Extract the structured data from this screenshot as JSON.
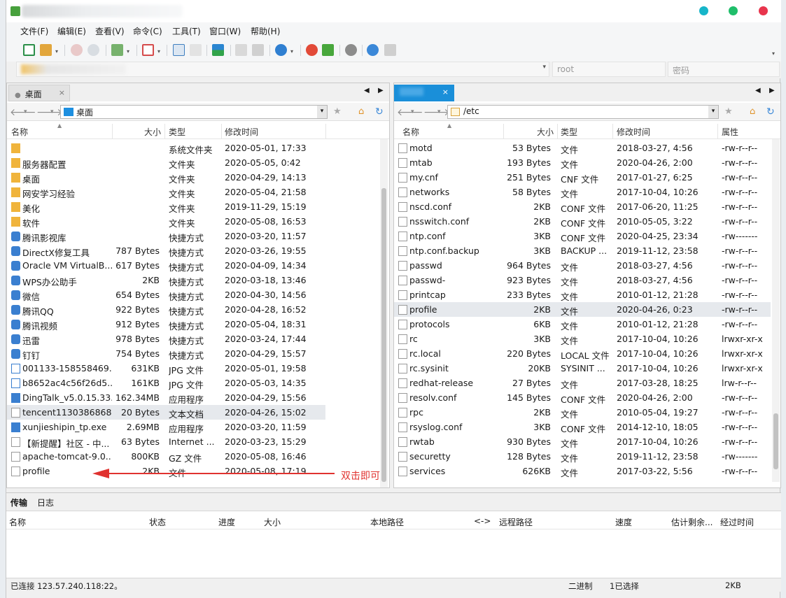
{
  "window": {
    "title": ""
  },
  "menu": [
    "文件(F)",
    "编辑(E)",
    "查看(V)",
    "命令(C)",
    "工具(T)",
    "窗口(W)",
    "帮助(H)"
  ],
  "connection": {
    "user_placeholder": "root",
    "password_placeholder": "密码"
  },
  "left_pane": {
    "tab_label": "桌面",
    "path": "桌面",
    "columns": [
      "名称",
      "大小",
      "类型",
      "修改时间"
    ],
    "rows": [
      {
        "name": "",
        "size": "",
        "type": "系统文件夹",
        "modified": "2020-05-01, 17:33"
      },
      {
        "name": "服务器配置",
        "size": "",
        "type": "文件夹",
        "modified": "2020-05-05, 0:42"
      },
      {
        "name": "桌面",
        "size": "",
        "type": "文件夹",
        "modified": "2020-04-29, 14:13"
      },
      {
        "name": "网安学习经验",
        "size": "",
        "type": "文件夹",
        "modified": "2020-05-04, 21:58"
      },
      {
        "name": "美化",
        "size": "",
        "type": "文件夹",
        "modified": "2019-11-29, 15:19"
      },
      {
        "name": "软件",
        "size": "",
        "type": "文件夹",
        "modified": "2020-05-08, 16:53"
      },
      {
        "name": "腾讯影视库",
        "size": "",
        "type": "快捷方式",
        "modified": "2020-03-20, 11:57"
      },
      {
        "name": "DirectX修复工具",
        "size": "787 Bytes",
        "type": "快捷方式",
        "modified": "2020-03-26, 19:55"
      },
      {
        "name": "Oracle VM VirtualB...",
        "size": "617 Bytes",
        "type": "快捷方式",
        "modified": "2020-04-09, 14:34"
      },
      {
        "name": "WPS办公助手",
        "size": "2KB",
        "type": "快捷方式",
        "modified": "2020-03-18, 13:46"
      },
      {
        "name": "微信",
        "size": "654 Bytes",
        "type": "快捷方式",
        "modified": "2020-04-30, 14:56"
      },
      {
        "name": "腾讯QQ",
        "size": "922 Bytes",
        "type": "快捷方式",
        "modified": "2020-04-28, 16:52"
      },
      {
        "name": "腾讯视频",
        "size": "912 Bytes",
        "type": "快捷方式",
        "modified": "2020-05-04, 18:31"
      },
      {
        "name": "迅雷",
        "size": "978 Bytes",
        "type": "快捷方式",
        "modified": "2020-03-24, 17:44"
      },
      {
        "name": "钉钉",
        "size": "754 Bytes",
        "type": "快捷方式",
        "modified": "2020-04-29, 15:57"
      },
      {
        "name": "001133-158558469...",
        "size": "631KB",
        "type": "JPG 文件",
        "modified": "2020-05-01, 19:58"
      },
      {
        "name": "b8652ac4c56f26d5...",
        "size": "161KB",
        "type": "JPG 文件",
        "modified": "2020-05-03, 14:35"
      },
      {
        "name": "DingTalk_v5.0.15.33...",
        "size": "162.34MB",
        "type": "应用程序",
        "modified": "2020-04-29, 15:56"
      },
      {
        "name": "tencent1130386868...",
        "size": "20 Bytes",
        "type": "文本文档",
        "modified": "2020-04-26, 15:02"
      },
      {
        "name": "xunjieshipin_tp.exe",
        "size": "2.69MB",
        "type": "应用程序",
        "modified": "2020-03-20, 11:59"
      },
      {
        "name": "【新提醒】社区 - 中...",
        "size": "63 Bytes",
        "type": "Internet ...",
        "modified": "2020-03-23, 15:29"
      },
      {
        "name": "apache-tomcat-9.0....",
        "size": "800KB",
        "type": "GZ 文件",
        "modified": "2020-05-08, 16:46"
      },
      {
        "name": "profile",
        "size": "2KB",
        "type": "文件",
        "modified": "2020-05-08, 17:19"
      }
    ]
  },
  "right_pane": {
    "path": "/etc",
    "columns": [
      "名称",
      "大小",
      "类型",
      "修改时间",
      "属性"
    ],
    "rows": [
      {
        "name": "motd",
        "size": "53 Bytes",
        "type": "文件",
        "modified": "2018-03-27, 4:56",
        "attr": "-rw-r--r--"
      },
      {
        "name": "mtab",
        "size": "193 Bytes",
        "type": "文件",
        "modified": "2020-04-26, 2:00",
        "attr": "-rw-r--r--"
      },
      {
        "name": "my.cnf",
        "size": "251 Bytes",
        "type": "CNF 文件",
        "modified": "2017-01-27, 6:25",
        "attr": "-rw-r--r--"
      },
      {
        "name": "networks",
        "size": "58 Bytes",
        "type": "文件",
        "modified": "2017-10-04, 10:26",
        "attr": "-rw-r--r--"
      },
      {
        "name": "nscd.conf",
        "size": "2KB",
        "type": "CONF 文件",
        "modified": "2017-06-20, 11:25",
        "attr": "-rw-r--r--"
      },
      {
        "name": "nsswitch.conf",
        "size": "2KB",
        "type": "CONF 文件",
        "modified": "2010-05-05, 3:22",
        "attr": "-rw-r--r--"
      },
      {
        "name": "ntp.conf",
        "size": "3KB",
        "type": "CONF 文件",
        "modified": "2020-04-25, 23:34",
        "attr": "-rw-------"
      },
      {
        "name": "ntp.conf.backup",
        "size": "3KB",
        "type": "BACKUP ...",
        "modified": "2019-11-12, 23:58",
        "attr": "-rw-r--r--"
      },
      {
        "name": "passwd",
        "size": "964 Bytes",
        "type": "文件",
        "modified": "2018-03-27, 4:56",
        "attr": "-rw-r--r--"
      },
      {
        "name": "passwd-",
        "size": "923 Bytes",
        "type": "文件",
        "modified": "2018-03-27, 4:56",
        "attr": "-rw-r--r--"
      },
      {
        "name": "printcap",
        "size": "233 Bytes",
        "type": "文件",
        "modified": "2010-01-12, 21:28",
        "attr": "-rw-r--r--"
      },
      {
        "name": "profile",
        "size": "2KB",
        "type": "文件",
        "modified": "2020-04-26, 0:23",
        "attr": "-rw-r--r--"
      },
      {
        "name": "protocols",
        "size": "6KB",
        "type": "文件",
        "modified": "2010-01-12, 21:28",
        "attr": "-rw-r--r--"
      },
      {
        "name": "rc",
        "size": "3KB",
        "type": "文件",
        "modified": "2017-10-04, 10:26",
        "attr": "lrwxr-xr-x"
      },
      {
        "name": "rc.local",
        "size": "220 Bytes",
        "type": "LOCAL 文件",
        "modified": "2017-10-04, 10:26",
        "attr": "lrwxr-xr-x"
      },
      {
        "name": "rc.sysinit",
        "size": "20KB",
        "type": "SYSINIT ...",
        "modified": "2017-10-04, 10:26",
        "attr": "lrwxr-xr-x"
      },
      {
        "name": "redhat-release",
        "size": "27 Bytes",
        "type": "文件",
        "modified": "2017-03-28, 18:25",
        "attr": "lrw-r--r--"
      },
      {
        "name": "resolv.conf",
        "size": "145 Bytes",
        "type": "CONF 文件",
        "modified": "2020-04-26, 2:00",
        "attr": "-rw-r--r--"
      },
      {
        "name": "rpc",
        "size": "2KB",
        "type": "文件",
        "modified": "2010-05-04, 19:27",
        "attr": "-rw-r--r--"
      },
      {
        "name": "rsyslog.conf",
        "size": "3KB",
        "type": "CONF 文件",
        "modified": "2014-12-10, 18:05",
        "attr": "-rw-r--r--"
      },
      {
        "name": "rwtab",
        "size": "930 Bytes",
        "type": "文件",
        "modified": "2017-10-04, 10:26",
        "attr": "-rw-r--r--"
      },
      {
        "name": "securetty",
        "size": "128 Bytes",
        "type": "文件",
        "modified": "2019-11-12, 23:58",
        "attr": "-rw-------"
      },
      {
        "name": "services",
        "size": "626KB",
        "type": "文件",
        "modified": "2017-03-22, 5:56",
        "attr": "-rw-r--r--"
      }
    ]
  },
  "transfer": {
    "tabs": [
      "传输",
      "日志"
    ],
    "columns": [
      "名称",
      "状态",
      "进度",
      "大小",
      "本地路径",
      "<->",
      "远程路径",
      "速度",
      "估计剩余...",
      "经过时间"
    ]
  },
  "status": {
    "connection": "已连接 123.57.240.118:22。",
    "mode": "二进制",
    "selected": "1已选择",
    "size": "2KB"
  },
  "annotation": "双击即可",
  "colors": {
    "accent_tab": "#1a8fd9",
    "arrow": "#e0322f",
    "selected_row": "#e6e9ed"
  }
}
